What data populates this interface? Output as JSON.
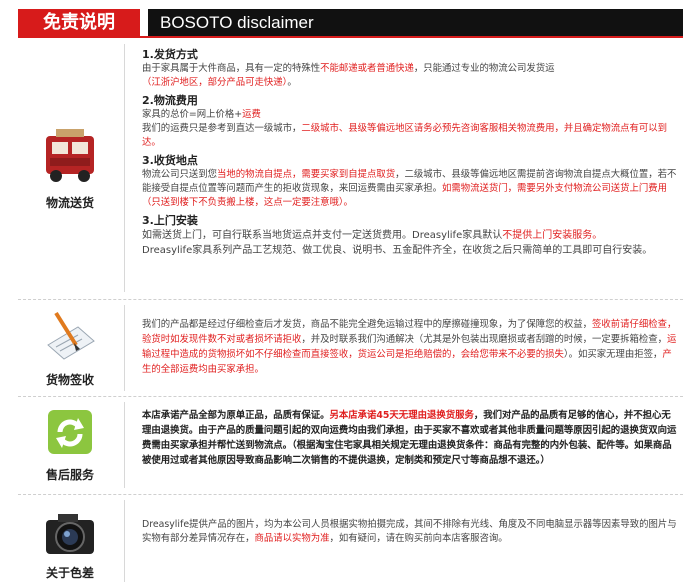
{
  "header": {
    "cn_title": "免责说明",
    "en_title": "BOSOTO disclaimer"
  },
  "logistics": {
    "label": "物流送货",
    "items": [
      {
        "title": "1.发货方式",
        "lines": [
          [
            "由于家具属于大件商品，具有一定的特殊性",
            "不能邮递或者普通快递",
            "，只能通过专业的物流公司发货运"
          ],
          [
            "（江浙沪地区，部分产品可走快递）",
            "",
            "。"
          ]
        ]
      },
      {
        "title": "2.物流费用",
        "lines": [
          [
            "家具的总价=网上价格+",
            "运费",
            ""
          ],
          [
            "我们的运费只是参考到直达一级城市，",
            "二级城市、县级等偏远地区请务必预先咨询客服相关物流费用，并且确定物流点有可以到达。",
            ""
          ]
        ]
      },
      {
        "title": "3.收货地点",
        "lines": [
          [
            "物流公司只送到您",
            "当地的物流自提点，需要买家到自提点取货",
            "，二级城市、县级等偏远地区需提前咨询物流自提点大概位置，若不能接受自提点位置等问题而产生的拒收货现象，来回运费需由买家承担。"
          ],
          [
            "",
            "如需物流送货门，需要另外支付物流公司送货上门费用（只送到楼下不负责搬上楼，这点一定要注意哦）。",
            ""
          ]
        ]
      },
      {
        "title": "3.上门安装",
        "lines": [
          [
            "如需送货上门，可自行联系当地货运点并支付一定送货费用。Dreasylife家具默认",
            "不提供上门安装服务。",
            ""
          ],
          [
            "Dreasylife家具系列产品工艺规范、做工优良、说明书、五金配件齐全，在收货之后只需简单的工具即可自行安装。",
            "",
            ""
          ]
        ]
      }
    ]
  },
  "inspection": {
    "label": "货物签收",
    "text": [
      [
        "我们的产品都是经过仔细检查后才发货，商品不能完全避免运输过程中的摩擦碰撞现象，为了保障您的权益，",
        "签收前请仔细检查，验货时如发现件数不对或者损坏请拒收",
        "，并及时联系我们沟通解决（尤其是外包装出现磨损或者刮蹭的时候，一定要拆箱检查，",
        "运输过程中造成的货物损坏如不仔细检查而直接签收，货运公司是拒绝赔偿的，会给您带来不必要的损失",
        "）。如买家无理由拒签，",
        "产生的全部运费均由买家承担。"
      ]
    ]
  },
  "aftersale": {
    "label": "售后服务",
    "text": [
      [
        "本店承诺产品全部为原单正品，品质有保证。",
        "另本店承诺45天无理由退换货服务",
        "，我们对产品的品质有足够的信心，并不担心无理由退换货。由于产品的质量问题引起的双向运费均由我们承担，由于买家不喜欢或者其他非质量问题等原因引起的退换货双向运费需由买家承担并帮忙送到物流点。（根据淘宝住宅家具相关规定无理由退换货条件：商品有完整的内外包装、配件等。如果商品被使用过或者其他原因导致商品影响二次销售的不提供退换，定制类和预定尺寸等商品想不退还。）"
      ]
    ]
  },
  "color": {
    "label": "关于色差",
    "text": [
      [
        "Dreasylife提供产品的图片，均为本公司人员根据实物拍摄完成，其间不排除有光线、角度及不同电脑显示器等因素导致的图片与实物有部分差异情况存在，",
        "商品请以实物为准",
        "，如有疑问，请在购买前向本店客服咨询。"
      ]
    ]
  },
  "colors": {
    "accent": "#d71b1b",
    "highlight": "#e01e1e",
    "header_dark": "#111111"
  },
  "icons": [
    "truck-icon",
    "signature-icon",
    "refresh-icon",
    "camera-icon"
  ]
}
